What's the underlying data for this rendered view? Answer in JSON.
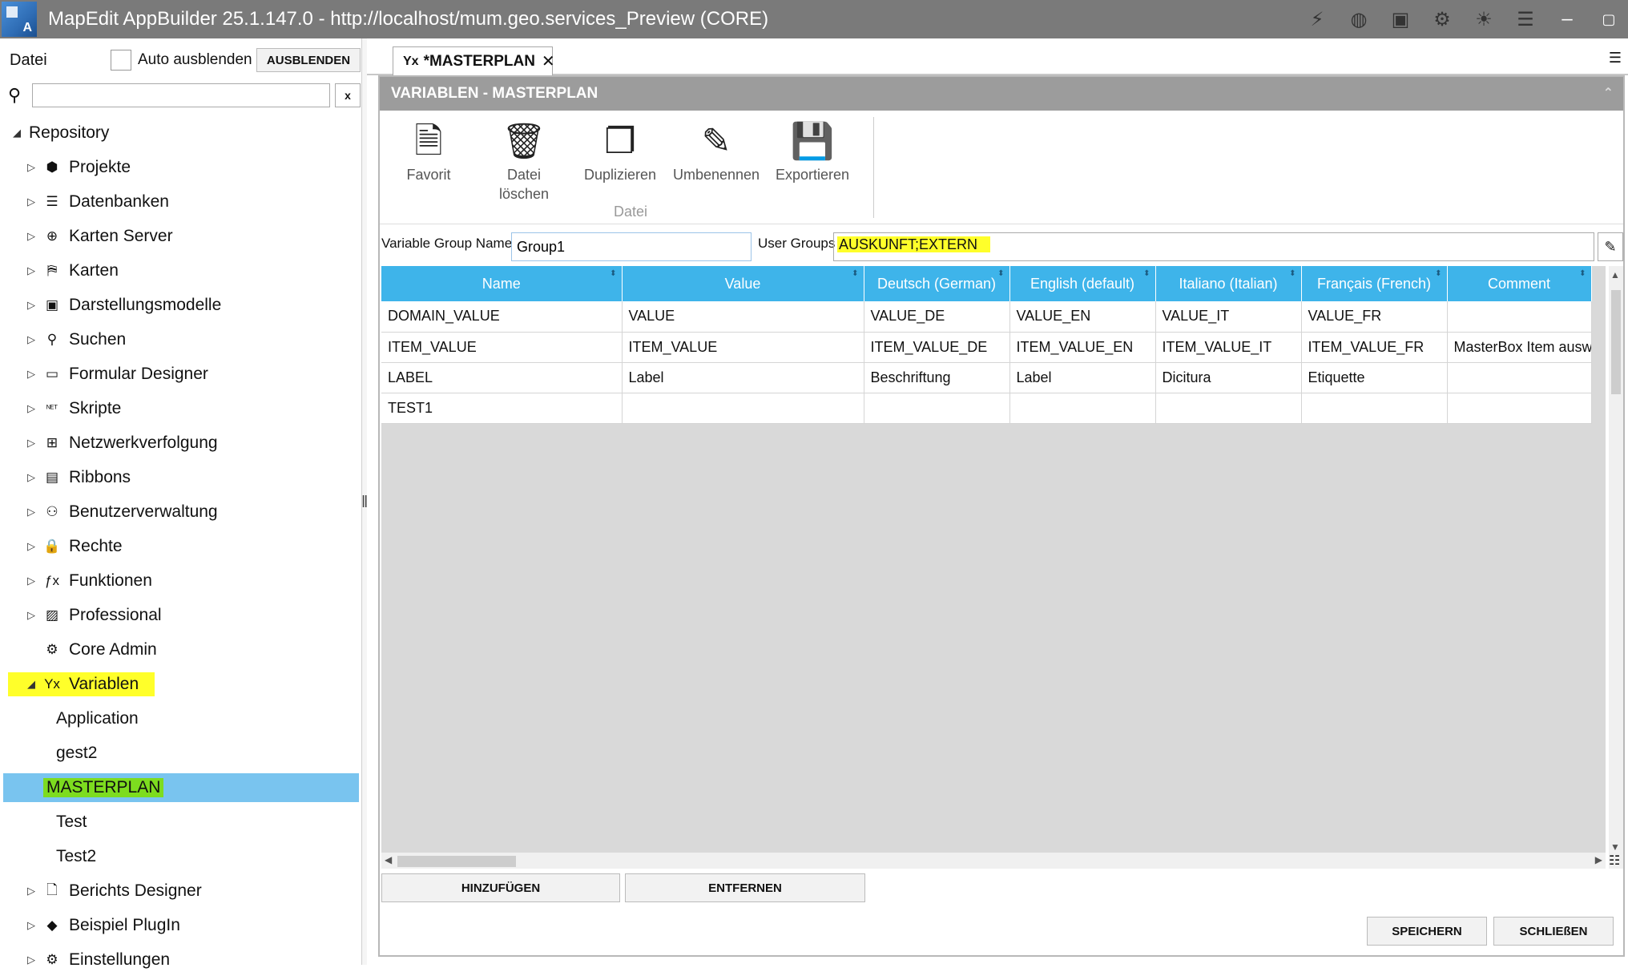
{
  "window": {
    "title": "MapEdit AppBuilder 25.1.147.0   -   http://localhost/mum.geo.services_Preview (CORE)",
    "icons": [
      "lightning-icon",
      "globe-icon",
      "save-icon",
      "gear-icon",
      "bulb-icon",
      "list-icon",
      "minimize-icon",
      "maximize-icon"
    ]
  },
  "left": {
    "datei": "Datei",
    "auto_hide": "Auto ausblenden",
    "hide_button": "AUSBLENDEN",
    "search_placeholder": "",
    "search_clear": "x",
    "tree": [
      {
        "label": "Repository",
        "icon": "",
        "level": 0
      },
      {
        "label": "Projekte",
        "icon": "cube-icon",
        "level": 1
      },
      {
        "label": "Datenbanken",
        "icon": "database-icon",
        "level": 1
      },
      {
        "label": "Karten Server",
        "icon": "globe-icon",
        "level": 1
      },
      {
        "label": "Karten",
        "icon": "map-icon",
        "level": 1
      },
      {
        "label": "Darstellungsmodelle",
        "icon": "style-icon",
        "level": 1
      },
      {
        "label": "Suchen",
        "icon": "search-icon",
        "level": 1
      },
      {
        "label": "Formular Designer",
        "icon": "form-icon",
        "level": 1
      },
      {
        "label": "Skripte",
        "icon": "net-icon",
        "level": 1
      },
      {
        "label": "Netzwerkverfolgung",
        "icon": "network-icon",
        "level": 1
      },
      {
        "label": "Ribbons",
        "icon": "ribbon-icon",
        "level": 1
      },
      {
        "label": "Benutzerverwaltung",
        "icon": "users-icon",
        "level": 1
      },
      {
        "label": "Rechte",
        "icon": "lock-icon",
        "level": 1
      },
      {
        "label": "Funktionen",
        "icon": "function-icon",
        "level": 1
      },
      {
        "label": "Professional",
        "icon": "image-icon",
        "level": 1
      },
      {
        "label": "Core Admin",
        "icon": "gear-icon",
        "level": 1
      },
      {
        "label": "Variablen",
        "icon": "variable-icon",
        "level": 1
      },
      {
        "label": "Application",
        "icon": "",
        "level": 2
      },
      {
        "label": "gest2",
        "icon": "",
        "level": 2
      },
      {
        "label": "MASTERPLAN",
        "icon": "",
        "level": 2
      },
      {
        "label": "Test",
        "icon": "",
        "level": 2
      },
      {
        "label": "Test2",
        "icon": "",
        "level": 2
      },
      {
        "label": "Berichts Designer",
        "icon": "document-icon",
        "level": 1
      },
      {
        "label": "Beispiel PlugIn",
        "icon": "tag-icon",
        "level": 1
      },
      {
        "label": "Einstellungen",
        "icon": "gear-icon",
        "level": 1
      }
    ]
  },
  "tab": {
    "label": "*MASTERPLAN",
    "prefix": "Yx"
  },
  "panel": {
    "header": "VARIABLEN - MASTERPLAN",
    "ribbon": [
      {
        "label": "Favorit"
      },
      {
        "label": "Datei\nlöschen"
      },
      {
        "label": "Duplizieren"
      },
      {
        "label": "Umbenennen"
      },
      {
        "label": "Exportieren"
      }
    ],
    "ribbon_group": "Datei",
    "variable_group_label": "Variable Group Name",
    "variable_group_value": "Group1",
    "user_groups_label": "User Groups",
    "user_groups_value": "AUSKUNFT;EXTERN"
  },
  "grid": {
    "columns": [
      "Name",
      "Value",
      "Deutsch (German)",
      "English (default)",
      "Italiano (Italian)",
      "Français (French)",
      "Comment"
    ],
    "rows": [
      [
        "DOMAIN_VALUE",
        "VALUE",
        "VALUE_DE",
        "VALUE_EN",
        "VALUE_IT",
        "VALUE_FR",
        ""
      ],
      [
        "ITEM_VALUE",
        "ITEM_VALUE",
        "ITEM_VALUE_DE",
        "ITEM_VALUE_EN",
        "ITEM_VALUE_IT",
        "ITEM_VALUE_FR",
        "MasterBox Item ausw"
      ],
      [
        "LABEL",
        "Label",
        "Beschriftung",
        "Label",
        "Dicitura",
        "Etiquette",
        ""
      ],
      [
        "TEST1",
        "",
        "",
        "",
        "",
        "",
        ""
      ]
    ]
  },
  "buttons": {
    "add": "HINZUFÜGEN",
    "remove": "ENTFERNEN",
    "save": "SPEICHERN",
    "close": "SCHLIEßEN"
  }
}
